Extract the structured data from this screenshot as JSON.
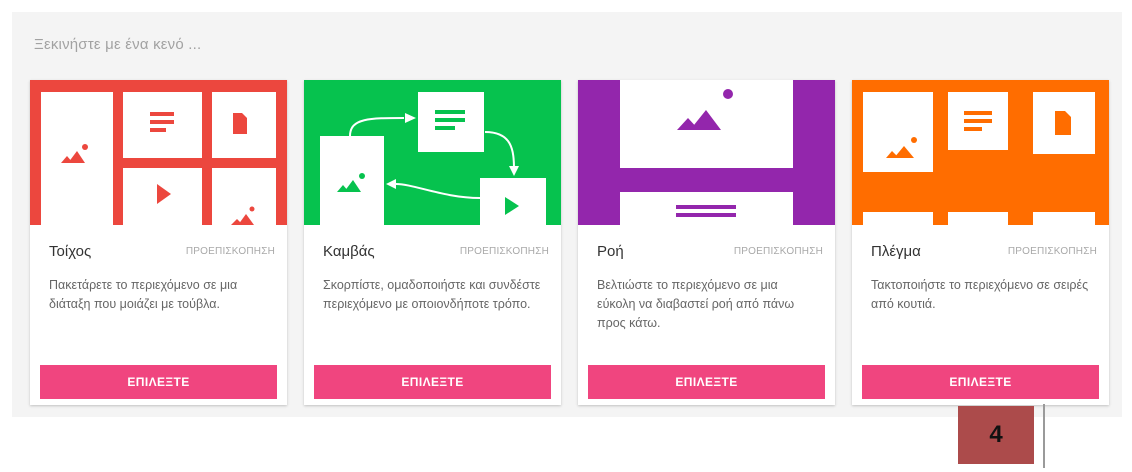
{
  "heading": "Ξεκινήστε με ένα κενό ...",
  "preview_label": "ΠΡΟΕΠΙΣΚΟΠΗΣΗ",
  "choose_label": "ΕΠΙΛΕΞΤΕ",
  "page_number": "4",
  "colors": {
    "wall": "#ec473e",
    "canvas": "#06c24e",
    "stream": "#9326ac",
    "grid": "#ff6d00",
    "extra_blue": "#2b7ff0",
    "extra_yellow": "#ffd600",
    "accent_button": "#f0457f"
  },
  "cards": [
    {
      "title": "Τοίχος",
      "description": "Πακετάρετε το περιεχόμενο σε μια διάταξη που μοιάζει με τούβλα.",
      "thumbnail": "wall-layout"
    },
    {
      "title": "Καμβάς",
      "description": "Σκορπίστε, ομαδοποιήστε και συνδέστε περιεχόμενο με οποιονδήποτε τρόπο.",
      "thumbnail": "canvas-layout"
    },
    {
      "title": "Ροή",
      "description": "Βελτιώστε το περιεχόμενο σε μια εύκολη να διαβαστεί ροή από πάνω προς κάτω.",
      "thumbnail": "stream-layout"
    },
    {
      "title": "Πλέγμα",
      "description": "Τακτοποιήστε το περιεχόμενο σε σειρές από κουτιά.",
      "thumbnail": "grid-layout"
    }
  ]
}
